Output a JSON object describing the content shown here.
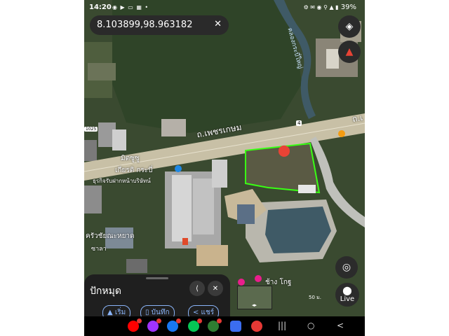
{
  "status_bar": {
    "time": "14:20",
    "left_icons": "◉ ▶ ▭ ▦ •",
    "right_icons": "⚙ ✉ ◉ ⚲ ▲ ▮",
    "battery": "39%"
  },
  "search": {
    "coordinates": "8.103899,98.963182",
    "close_label": "✕"
  },
  "map": {
    "road_name": "ถ.เพชรเกษม",
    "road_name_right": "ถ.เ",
    "route_number": "4",
    "route_1025": "1025",
    "canal_label": "คลองกระบี่ใหญ่",
    "resort_label_1": "มิตซูซู",
    "resort_label_2": "เกียรติ กระบี่",
    "resort_label_3": "ธุรกิจรับฝากหน้าบริษัทน์",
    "trucks_label": "ครัวชัยณะหยาด",
    "sala_label": "ซาลา",
    "chang_label": "ช้าง โกฐ",
    "mi_label": "มี",
    "scale_label": "50 ม.",
    "scale_label_2": "5ต",
    "colors": {
      "vegetation": "#3a4a30",
      "forest": "#2f4428",
      "road": "#c8c0a6",
      "water": "#3f5a66",
      "highlight": "#39ff14",
      "marker": "#e84335"
    }
  },
  "buttons": {
    "layers_icon": "◈",
    "compass_icon": "▲",
    "locate_icon": "◎",
    "live_label": "Live"
  },
  "sheet": {
    "title": "ปักหมุด",
    "share_icon": "⟨",
    "close_icon": "✕",
    "chip_1": "▲ เริ่ม",
    "chip_2": "▯ บันทึก",
    "chip_3": "< แชร์"
  },
  "navbar": {
    "recent": "|||",
    "home": "○",
    "back": "<",
    "apps": [
      {
        "name": "youtube",
        "color": "#ff0000",
        "badge": true
      },
      {
        "name": "messenger",
        "color": "#a033ff",
        "badge": true
      },
      {
        "name": "facebook",
        "color": "#1877f2",
        "badge": true
      },
      {
        "name": "line",
        "color": "#06c755",
        "badge": true
      },
      {
        "name": "phone",
        "color": "#2e7d32",
        "badge": true
      },
      {
        "name": "settings-app",
        "color": "#3b6df0",
        "badge": false
      },
      {
        "name": "car-app",
        "color": "#e53935",
        "badge": false
      }
    ]
  }
}
